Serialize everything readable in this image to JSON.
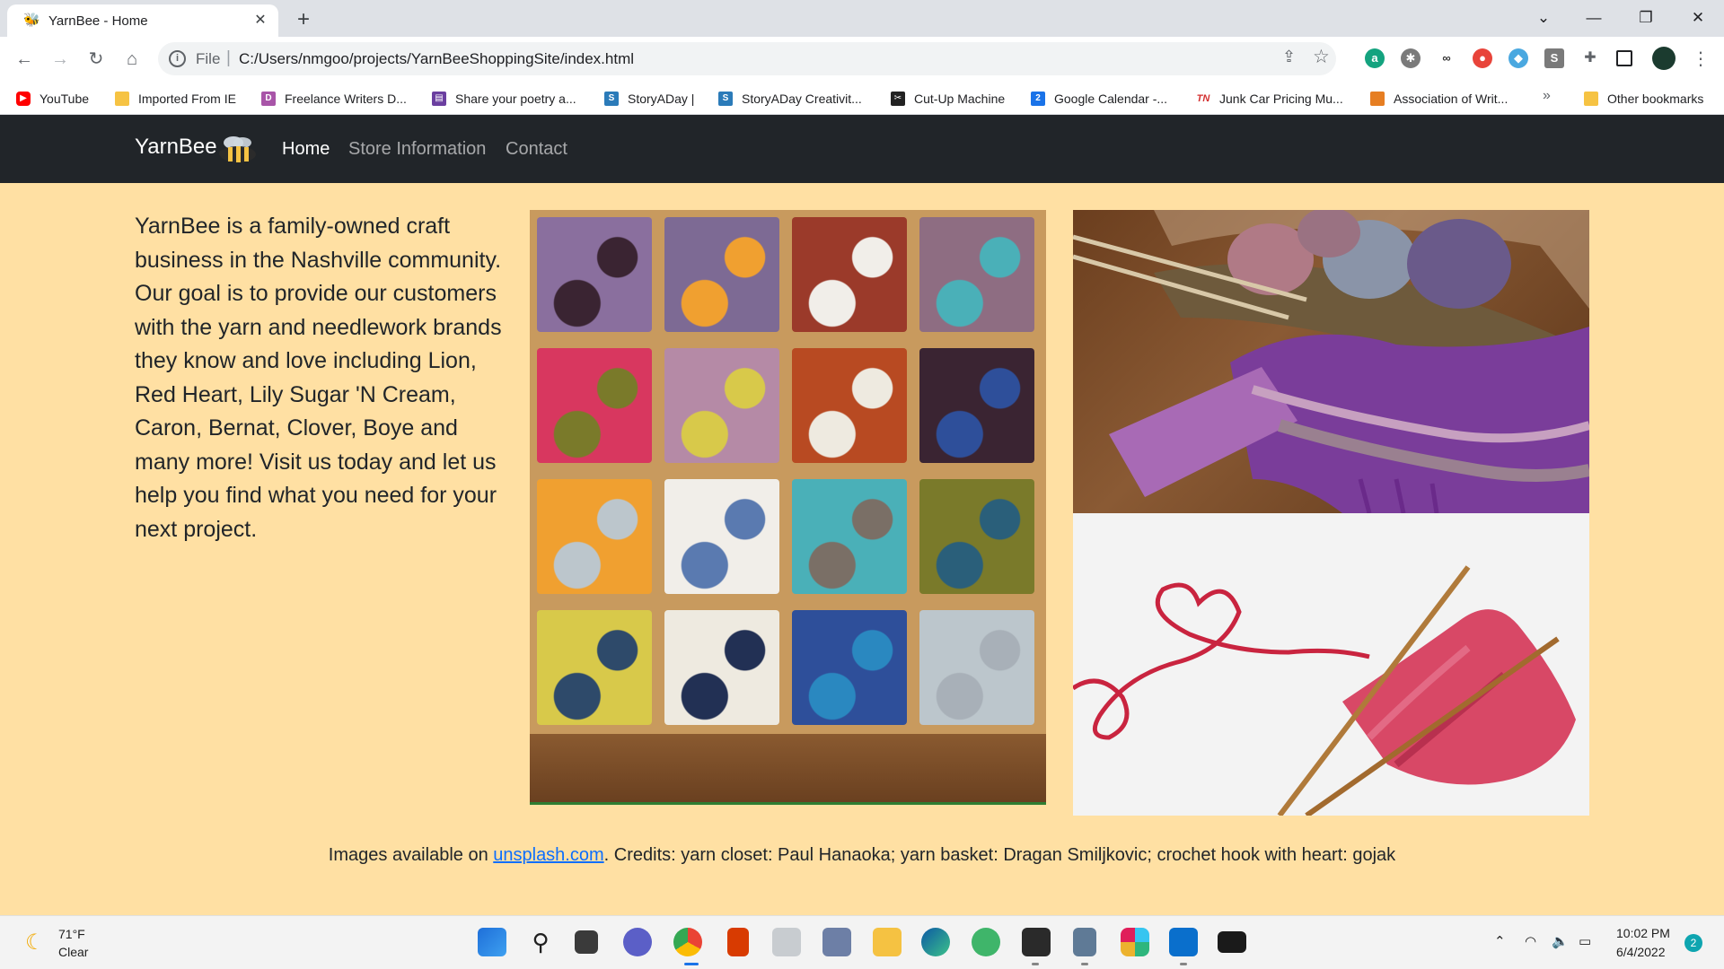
{
  "browser": {
    "tab": {
      "title": "YarnBee - Home",
      "favicon": "bee-icon"
    },
    "omnibox": {
      "scheme_label": "File",
      "url": "C:/Users/nmgoo/projects/YarnBeeShoppingSite/index.html"
    },
    "bookmarks": [
      {
        "label": "YouTube",
        "icon": "youtube-icon",
        "color": "#ff0000"
      },
      {
        "label": "Imported From IE",
        "icon": "folder-icon",
        "color": "#f6c343"
      },
      {
        "label": "Freelance Writers D...",
        "icon": "d-icon",
        "color": "#a855a8"
      },
      {
        "label": "Share your poetry a...",
        "icon": "book-icon",
        "color": "#6b3fa0"
      },
      {
        "label": "StoryADay |",
        "icon": "s-icon",
        "color": "#2b7bb9"
      },
      {
        "label": "StoryADay Creativit...",
        "icon": "s-icon",
        "color": "#2b7bb9"
      },
      {
        "label": "Cut-Up Machine",
        "icon": "scissors-icon",
        "color": "#222222"
      },
      {
        "label": "Google Calendar -...",
        "icon": "calendar-icon",
        "color": "#1a73e8"
      },
      {
        "label": "Junk Car Pricing Mu...",
        "icon": "tn-icon",
        "color": "#d32f2f"
      },
      {
        "label": "Association of Writ...",
        "icon": "bookmark-icon",
        "color": "#e67e22"
      }
    ],
    "more_bookmarks": "»",
    "other_bookmarks": "Other bookmarks"
  },
  "site": {
    "brand": "YarnBee",
    "nav": {
      "home": "Home",
      "store": "Store Information",
      "contact": "Contact"
    },
    "intro": "YarnBee is a family-owned craft business in the Nashville community. Our goal is to provide our customers with the yarn and needlework brands they know and love including Lion, Red Heart, Lily Sugar 'N Cream, Caron, Bernat, Clover, Boye and many more! Visit us today and let us help you find what you need for your next project.",
    "credits": {
      "prefix": "Images available on ",
      "link": "unsplash.com",
      "suffix": ". Credits: yarn closet: Paul Hanaoka; yarn basket: Dragan Smiljkovic; crochet hook with heart: gojak"
    },
    "yarn_colors": [
      "#8a6f9e",
      "#7d6a94",
      "#9b3a2a",
      "#8e6d82",
      "#d8375f",
      "#b58aa6",
      "#b84a22",
      "#3a2432",
      "#f0a030",
      "#f1eee9",
      "#4ab0b8",
      "#7a7a2a",
      "#d8c94a",
      "#eeeae0",
      "#2e4f9a",
      "#bcc6cc",
      "#5a7ab0",
      "#7a6f66",
      "#2a5f7a",
      "#2e4a6a",
      "#223054",
      "#2a88c0",
      "#a8b0b8",
      "#3a3c40"
    ]
  },
  "taskbar": {
    "weather": {
      "temp": "71°F",
      "condition": "Clear"
    },
    "clock": {
      "time": "10:02 PM",
      "date": "6/4/2022"
    },
    "notifications": "2"
  }
}
